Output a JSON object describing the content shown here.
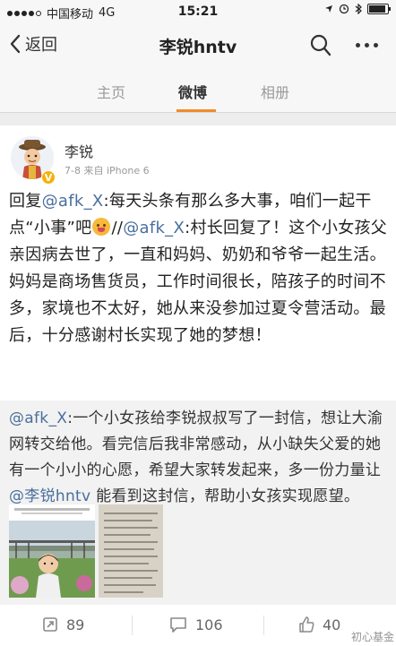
{
  "status_bar": {
    "carrier": "中国移动",
    "network": "4G",
    "time": "15:21",
    "battery_level": 0.9
  },
  "nav": {
    "back_label": "返回",
    "title": "李锐hntv"
  },
  "tabs": [
    {
      "label": "主页",
      "active": false
    },
    {
      "label": "微博",
      "active": true
    },
    {
      "label": "相册",
      "active": false
    }
  ],
  "post": {
    "author": "李锐",
    "meta": "7-8  来自 iPhone 6",
    "text": {
      "prefix": "回复",
      "mention1": "@afk_X",
      "part1": ":每天头条有那么多大事，咱们一起干点“小事”吧",
      "part2": "//",
      "mention2": "@afk_X",
      "part3": ":村长回复了！这个小女孩父亲因病去世了，一直和妈妈、奶奶和爷爷一起生活。妈妈是商场售货员，工作时间很长，陪孩子的时间不多，家境也不太好，她从来没参加过夏令营活动。最后，十分感谢村长实现了她的梦想！"
    },
    "repost": {
      "mention1": "@afk_X",
      "part1": ":一个小女孩给李锐叔叔写了一封信，想让大渝网转交给他。看完信后我非常感动，从小缺失父爱的她有一个小小的心愿，希望大家转发起来，多一份力量让",
      "mention2": "@李锐hntv",
      "part2": " 能看到这封信，帮助小女孩实现愿望。"
    },
    "actions": {
      "repost_count": "89",
      "comment_count": "106",
      "like_count": "40"
    }
  },
  "watermark": "初心基金",
  "colors": {
    "accent": "#f28b2a",
    "mention": "#4a6f9e",
    "verified": "#f5b10b"
  }
}
